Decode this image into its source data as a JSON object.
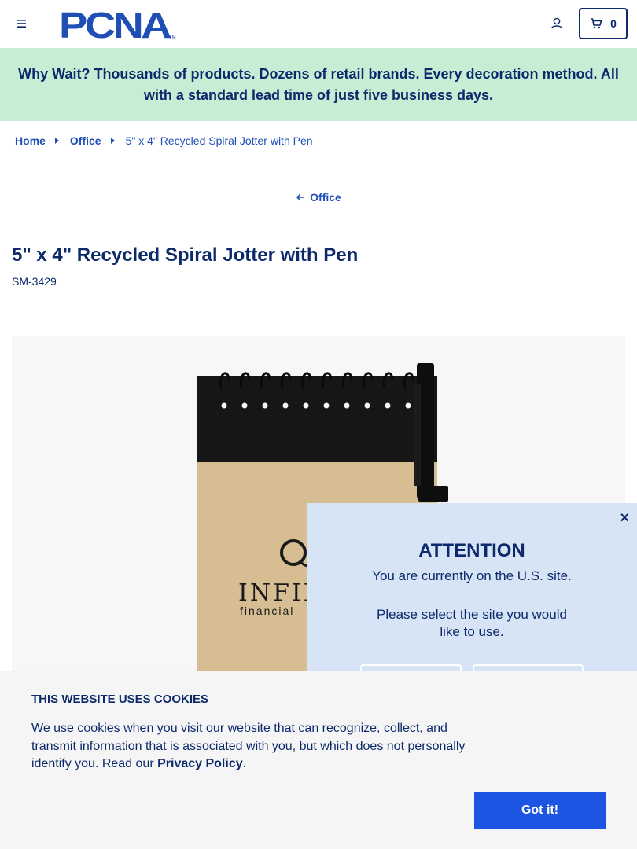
{
  "header": {
    "logo_text": "PCNA",
    "logo_tm": "TM",
    "cart_count": "0"
  },
  "banner": {
    "text": "Why Wait? Thousands of products. Dozens of retail brands. Every decoration method. All with a standard lead time of just five business days."
  },
  "breadcrumb": {
    "items": [
      "Home",
      "Office"
    ],
    "current": "5\" x 4\" Recycled Spiral Jotter with Pen"
  },
  "back_link": {
    "label": "Office"
  },
  "product": {
    "title": "5\" x 4\" Recycled Spiral Jotter with Pen",
    "sku": "SM-3429",
    "imprint_text_1": "INFIN",
    "imprint_text_2": "financial"
  },
  "modal": {
    "close_label": "×",
    "title": "ATTENTION",
    "line1": "You are currently on the U.S. site.",
    "line2": "Please select the site you would",
    "line3": "like to use."
  },
  "cookie": {
    "title": "THIS WEBSITE USES COOKIES",
    "text_before": "We use cookies when you visit our website that can recognize, collect, and transmit information that is associated with you, but which does not personally identify you. Read our ",
    "link": "Privacy Policy",
    "text_after": ".",
    "button": "Got it!"
  },
  "colors": {
    "navy": "#0c2a6b",
    "link_blue": "#1f4fb5",
    "banner_green": "#c8edd5",
    "modal_blue": "#d6e4f5",
    "button_blue": "#1b55e2"
  },
  "icons": {
    "menu": "hamburger-icon",
    "account": "user-icon",
    "cart": "cart-icon",
    "crumb_separator": "caret-right-icon",
    "back": "arrow-left-icon"
  }
}
